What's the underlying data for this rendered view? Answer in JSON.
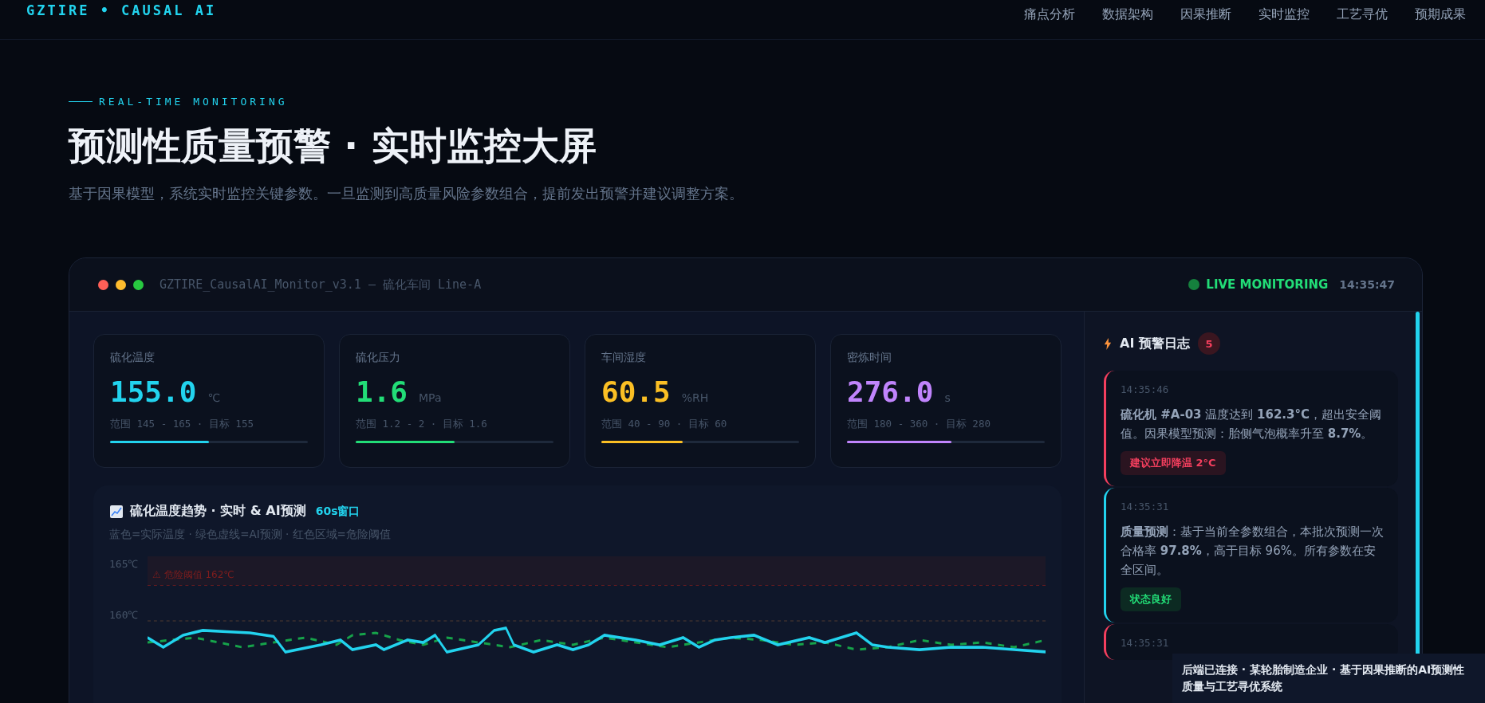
{
  "header": {
    "logo": "GZTIRE • CAUSAL AI",
    "nav": [
      "痛点分析",
      "数据架构",
      "因果推断",
      "实时监控",
      "工艺寻优",
      "预期成果"
    ]
  },
  "hero": {
    "eyebrow": "REAL-TIME MONITORING",
    "title": "预测性质量预警 · 实时监控大屏",
    "description": "基于因果模型，系统实时监控关键参数。一旦监测到高质量风险参数组合，提前发出预警并建议调整方案。"
  },
  "monitor": {
    "title": "GZTIRE_CausalAI_Monitor_v3.1 — 硫化车间 Line-A",
    "live": "LIVE MONITORING",
    "time": "14:35:47",
    "metrics": [
      {
        "label": "硫化温度",
        "value": "155.0",
        "unit": "℃",
        "range": "范围 145 - 165 · 目标 155",
        "level": 0.5,
        "color": "#22d3ee"
      },
      {
        "label": "硫化压力",
        "value": "1.6",
        "unit": "MPa",
        "range": "范围 1.2 - 2 · 目标 1.6",
        "level": 0.5,
        "color": "#22dd77"
      },
      {
        "label": "车间湿度",
        "value": "60.5",
        "unit": "%RH",
        "range": "范围 40 - 90 · 目标 60",
        "level": 0.41,
        "color": "#fbbf24"
      },
      {
        "label": "密炼时间",
        "value": "276.0",
        "unit": "s",
        "range": "范围 180 - 360 · 目标 280",
        "level": 0.53,
        "color": "#c084fc"
      }
    ],
    "chart": {
      "title": "硫化温度趋势 · 实时 & AI预测",
      "badge": "60s窗口",
      "legend": "蓝色=实际温度 · 绿色虚线=AI预测 · 红色区域=危险阈值",
      "y_labels": [
        "165℃",
        "160℃"
      ],
      "threshold_label": "⚠ 危险阈值 162℃"
    },
    "log": {
      "title": "AI 预警日志",
      "count": "5",
      "alerts": [
        {
          "kind": "danger",
          "time": "14:35:46",
          "text": "**硫化机 #A-03** 温度达到 **162.3°C**，超出安全阈值。因果模型预测：胎侧气泡概率升至 **8.7%**。",
          "tag": "建议立即降温 2°C"
        },
        {
          "kind": "info",
          "time": "14:35:31",
          "text": "**质量预测**：基于当前全参数组合，本批次预测一次合格率 **97.8%**，高于目标 96%。所有参数在安全区间。",
          "tag": "状态良好"
        },
        {
          "kind": "danger",
          "time": "14:35:31"
        }
      ]
    }
  },
  "toast": {
    "text": "**后端已连接** · 某轮胎制造企业 · 基于因果推断的AI预测性质量与工艺寻优系统"
  }
}
